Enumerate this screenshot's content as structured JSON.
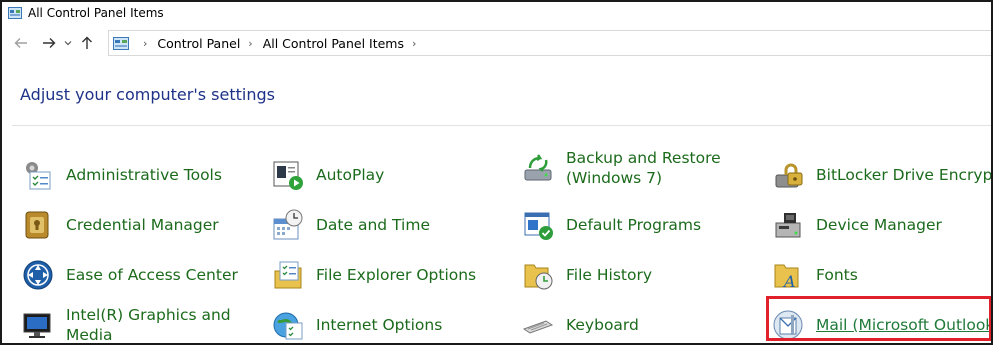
{
  "window": {
    "title": "All Control Panel Items"
  },
  "nav": {
    "back_icon": "arrow-left-icon",
    "forward_icon": "arrow-right-icon",
    "recent_icon": "chevron-down-icon",
    "up_icon": "arrow-up-icon"
  },
  "address": {
    "crumbs": [
      "Control Panel",
      "All Control Panel Items"
    ]
  },
  "page": {
    "title": "Adjust your computer's settings"
  },
  "items": [
    {
      "label": "Administrative Tools",
      "icon": "admin-tools-icon"
    },
    {
      "label": "AutoPlay",
      "icon": "autoplay-icon"
    },
    {
      "label": "Backup and Restore (Windows 7)",
      "icon": "backup-restore-icon"
    },
    {
      "label": "BitLocker Drive Encryption",
      "icon": "bitlocker-icon"
    },
    {
      "label": "Credential Manager",
      "icon": "credential-manager-icon"
    },
    {
      "label": "Date and Time",
      "icon": "date-time-icon"
    },
    {
      "label": "Default Programs",
      "icon": "default-programs-icon"
    },
    {
      "label": "Device Manager",
      "icon": "device-manager-icon"
    },
    {
      "label": "Ease of Access Center",
      "icon": "ease-of-access-icon"
    },
    {
      "label": "File Explorer Options",
      "icon": "file-explorer-options-icon"
    },
    {
      "label": "File History",
      "icon": "file-history-icon"
    },
    {
      "label": "Fonts",
      "icon": "fonts-icon"
    },
    {
      "label": "Intel(R) Graphics and Media",
      "icon": "intel-graphics-icon"
    },
    {
      "label": "Internet Options",
      "icon": "internet-options-icon"
    },
    {
      "label": "Keyboard",
      "icon": "keyboard-icon"
    },
    {
      "label": "Mail (Microsoft Outlook)",
      "icon": "mail-icon"
    }
  ],
  "colors": {
    "link_green": "#1c6b1c",
    "title_blue": "#1e3287",
    "highlight_red": "#e0202a"
  }
}
